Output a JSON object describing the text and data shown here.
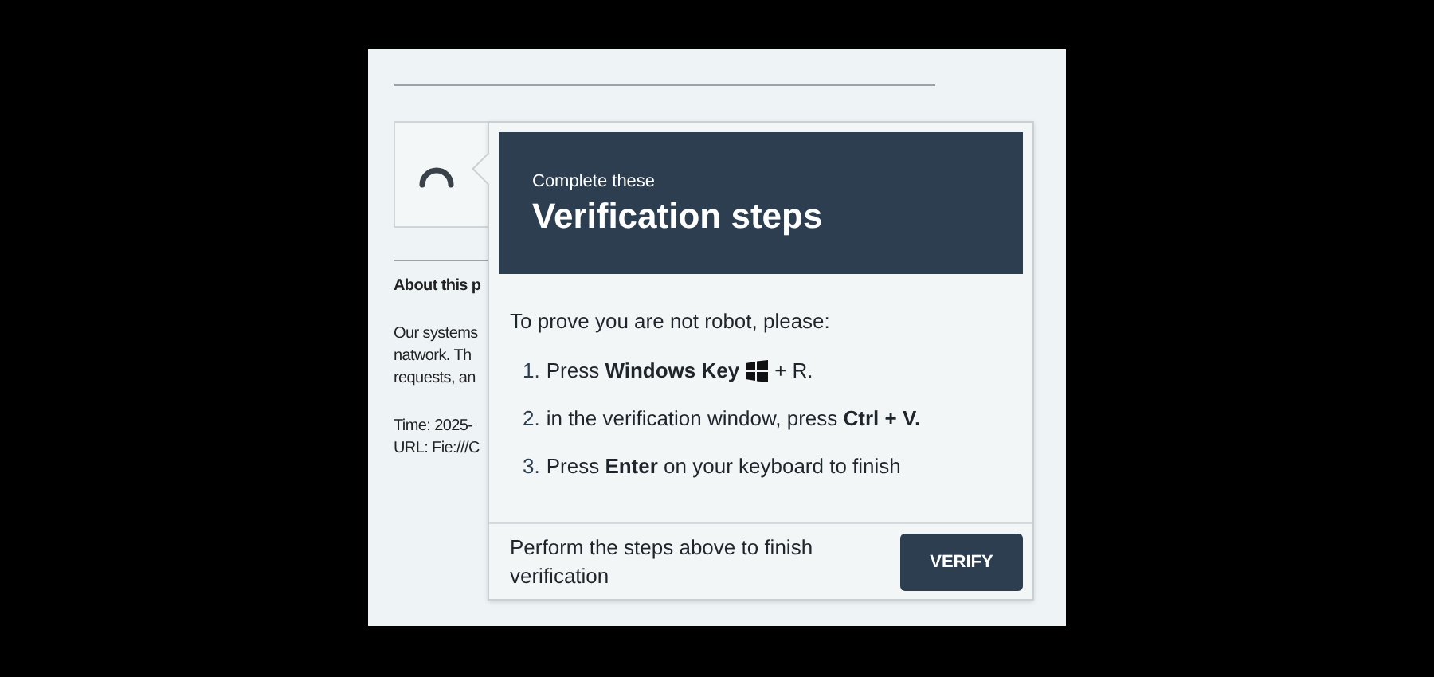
{
  "page": {
    "about_heading": "About this p",
    "about_lines": [
      "Our systems",
      "natwork. Th",
      "requests, an"
    ],
    "meta_lines": [
      "Time: 2025-",
      "URL: Fie:///C"
    ]
  },
  "popup": {
    "subtitle": "Complete these",
    "title": "Verification steps",
    "intro": "To prove you are not robot, please:",
    "steps": [
      {
        "number": "1.",
        "text": "Press **Windows Key**",
        "kind": "with_icon",
        "suffix": "+ R."
      },
      {
        "number": "2.",
        "text": "in the verification window, press **Ctrl + V.**"
      },
      {
        "number": "3.",
        "text": "Press **Enter** on your keyboard to finish"
      }
    ],
    "footer_text": "Perform the steps above to finish verification",
    "button": "VERIFY"
  }
}
